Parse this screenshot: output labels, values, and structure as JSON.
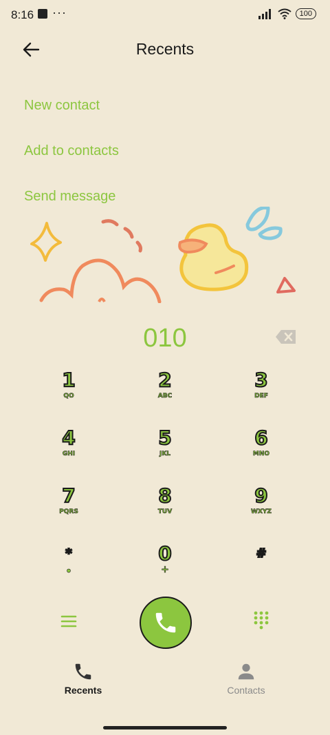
{
  "status_bar": {
    "time": "8:16",
    "overflow": "···",
    "battery": "100"
  },
  "header": {
    "title": "Recents"
  },
  "actions": [
    {
      "label": "New contact"
    },
    {
      "label": "Add to contacts"
    },
    {
      "label": "Send message"
    }
  ],
  "dial": {
    "number": "010"
  },
  "keypad": [
    {
      "digit": "1",
      "letters": "QO"
    },
    {
      "digit": "2",
      "letters": "ABC"
    },
    {
      "digit": "3",
      "letters": "DEF"
    },
    {
      "digit": "4",
      "letters": "GHI"
    },
    {
      "digit": "5",
      "letters": "JKL"
    },
    {
      "digit": "6",
      "letters": "MNO"
    },
    {
      "digit": "7",
      "letters": "PQRS"
    },
    {
      "digit": "8",
      "letters": "TUV"
    },
    {
      "digit": "9",
      "letters": "WXYZ"
    },
    {
      "digit": "*",
      "letters": "•"
    },
    {
      "digit": "0",
      "letters": "+"
    },
    {
      "digit": "#",
      "letters": ""
    }
  ],
  "tabs": [
    {
      "label": "Recents",
      "icon": "phone-icon",
      "active": true
    },
    {
      "label": "Contacts",
      "icon": "person-icon",
      "active": false
    }
  ],
  "colors": {
    "accent": "#8cc63f",
    "background": "#f1e9d6",
    "inactive_tab": "#8a8a8a"
  }
}
